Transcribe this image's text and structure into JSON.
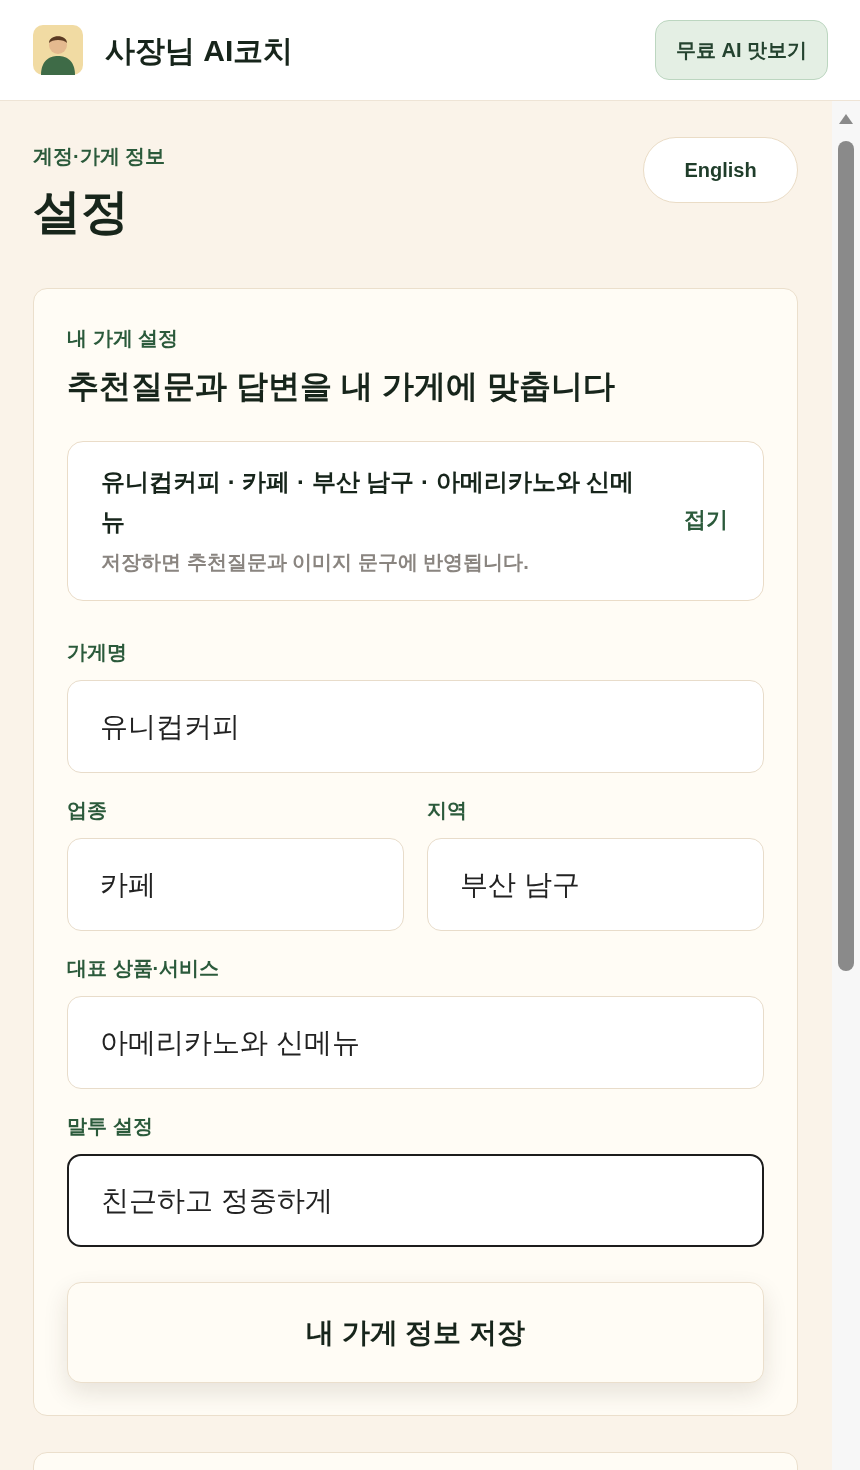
{
  "header": {
    "title": "사장님 AI코치",
    "trial_button": "무료 AI 맛보기"
  },
  "page": {
    "eyebrow": "계정·가게 정보",
    "title": "설정",
    "language_button": "English"
  },
  "store_card": {
    "eyebrow": "내 가게 설정",
    "heading": "추천질문과 답변을 내 가게에 맞춥니다",
    "summary": {
      "text": "유니컵커피 · 카페 · 부산 남구 · 아메리카노와 신메뉴",
      "hint": "저장하면 추천질문과 이미지 문구에 반영됩니다.",
      "toggle": "접기",
      "expanded": true
    },
    "field_rows": [
      [
        {
          "label": "가게명",
          "value": "유니컵커피",
          "focused": false
        }
      ],
      [
        {
          "label": "업종",
          "value": "카페",
          "focused": false
        },
        {
          "label": "지역",
          "value": "부산 남구",
          "focused": false
        }
      ],
      [
        {
          "label": "대표 상품·서비스",
          "value": "아메리카노와 신메뉴",
          "focused": false
        }
      ],
      [
        {
          "label": "말투 설정",
          "value": "친근하고 정중하게",
          "focused": true
        }
      ]
    ],
    "save_button": "내 가게 정보 저장"
  }
}
